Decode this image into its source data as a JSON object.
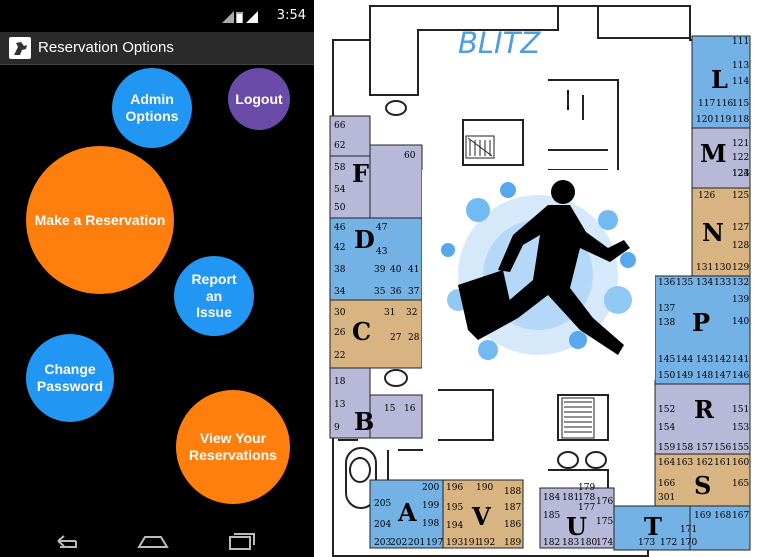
{
  "status": {
    "time": "3:54"
  },
  "app": {
    "title": "Reservation Options"
  },
  "buttons": {
    "admin": "Admin Options",
    "logout": "Logout",
    "reserve": "Make a Reservation",
    "report": "Report an Issue",
    "password": "Change Password",
    "view": "View Your Reservations"
  },
  "colors": {
    "blue": "#2196f3",
    "orange": "#ff7f0e",
    "purple": "#6a4ca8",
    "map_blue": "#74b2e6",
    "map_lav": "#b8b8d8",
    "map_tan": "#d7b481"
  },
  "icons": {
    "back": "back-icon",
    "home": "home-icon",
    "recents": "recents-icon"
  },
  "map": {
    "title": "BLITZ",
    "zones": [
      "L",
      "M",
      "N",
      "P",
      "R",
      "S",
      "T",
      "U",
      "V",
      "A",
      "B",
      "C",
      "D",
      "F"
    ],
    "rooms": {
      "L": [
        "111",
        "113",
        "114",
        "115",
        "116",
        "117",
        "118",
        "119",
        "120"
      ],
      "M": [
        "121",
        "122",
        "123",
        "124",
        "125",
        "126"
      ],
      "N": [
        "127",
        "128",
        "129",
        "130",
        "131"
      ],
      "P": [
        "132",
        "133",
        "134",
        "135",
        "136",
        "137",
        "138",
        "139",
        "140",
        "141",
        "142",
        "143",
        "144",
        "145",
        "146",
        "147",
        "148",
        "149",
        "150"
      ],
      "R": [
        "151",
        "152",
        "153",
        "154",
        "155",
        "156",
        "157",
        "158",
        "159"
      ],
      "S": [
        "160",
        "161",
        "162",
        "163",
        "164",
        "165",
        "166",
        "167",
        "168",
        "169",
        "301"
      ],
      "T": [
        "170",
        "171",
        "172",
        "173",
        "174"
      ],
      "U": [
        "175",
        "176",
        "177",
        "178",
        "179",
        "180",
        "181",
        "182",
        "183",
        "184",
        "185"
      ],
      "V": [
        "186",
        "187",
        "188",
        "189",
        "190",
        "191",
        "192",
        "193",
        "194",
        "195",
        "196"
      ],
      "A": [
        "197",
        "198",
        "199",
        "200",
        "201",
        "202",
        "203",
        "204",
        "205"
      ],
      "B": [
        "9",
        "13",
        "15",
        "16",
        "18"
      ],
      "C": [
        "22",
        "26",
        "27",
        "28",
        "30",
        "31",
        "32"
      ],
      "D": [
        "34",
        "35",
        "36",
        "37",
        "38",
        "39",
        "40",
        "41",
        "42",
        "43",
        "46",
        "47"
      ],
      "F": [
        "50",
        "54",
        "58",
        "60",
        "62",
        "66"
      ]
    }
  }
}
